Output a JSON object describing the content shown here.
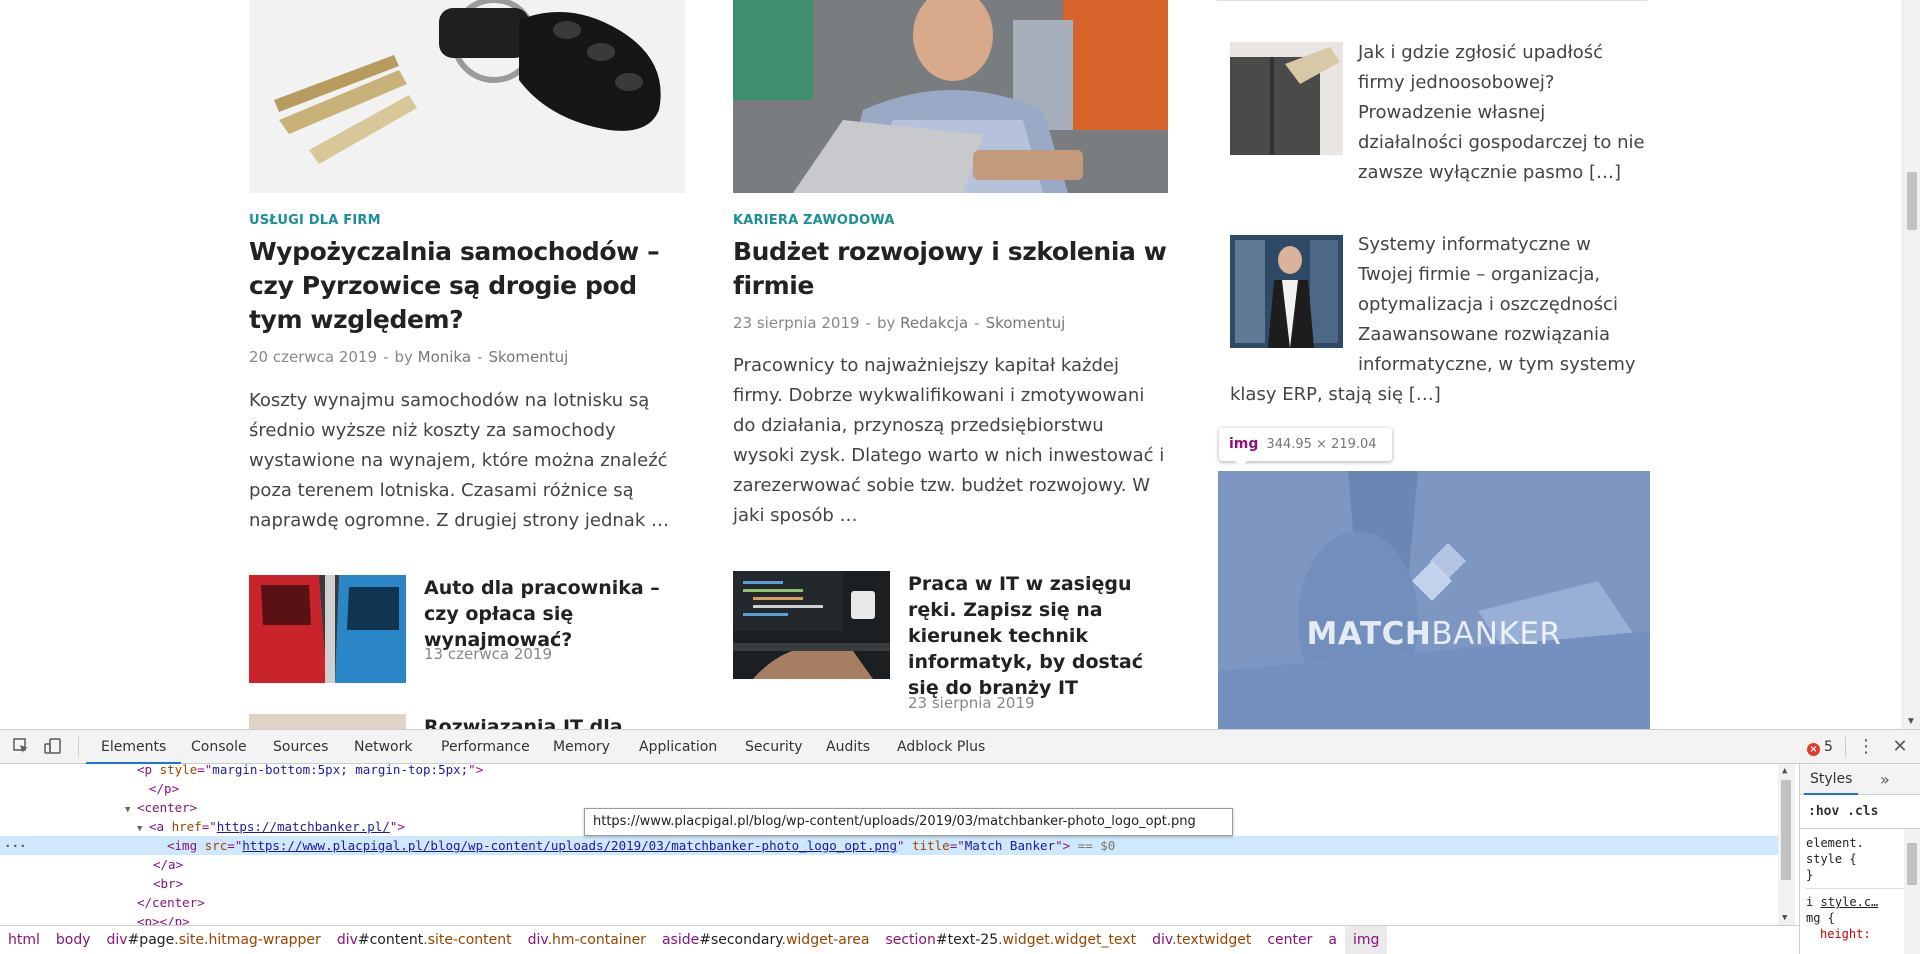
{
  "page": {
    "featured": [
      {
        "category": "USŁUGI DLA FIRM",
        "title": "Wypożyczalnia samochodów – czy Pyrzowice są drogie pod tym względem?",
        "date": "20 czerwca 2019",
        "by": "by",
        "author": "Monika",
        "comment": "Skomentuj",
        "excerpt": "Koszty wynajmu samochodów na lotnisku są średnio wyższe niż koszty za samochody wystawione na wynajem, które można znaleźć poza terenem lotniska. Czasami różnice są naprawdę ogromne. Z drugiej strony jednak …"
      },
      {
        "category": "KARIERA ZAWODOWA",
        "title": "Budżet rozwojowy i szkolenia w firmie",
        "date": "23 sierpnia 2019",
        "by": "by",
        "author": "Redakcja",
        "comment": "Skomentuj",
        "excerpt": "Pracownicy to najważniejszy kapitał każdej firmy. Dobrze wykwalifikowani i zmotywowani do działania, przynoszą przedsiębiorstwu wysoki zysk. Dlatego warto w nich inwestować i zarezerwować sobie tzw. budżet rozwojowy. W jaki sposób …"
      }
    ],
    "small_posts": [
      {
        "title": "Auto dla pracownika – czy opłaca się wynajmować?",
        "date": "13 czerwca 2019"
      },
      {
        "title": "Praca w IT w zasięgu ręki. Zapisz się na kierunek technik informatyk, by dostać się do branży IT",
        "date": "23 sierpnia 2019"
      },
      {
        "title": "Rozwiązania IT dla"
      }
    ],
    "sidebar": [
      {
        "lines": [
          "Jak i gdzie zgłosić upadłość",
          "firmy jednoosobowej?",
          "Prowadzenie własnej",
          "działalności gospodarczej to nie",
          "zawsze wyłącznie pasmo […]"
        ]
      },
      {
        "lines": [
          "Systemy informatyczne w",
          "Twojej firmie – organizacja,",
          "optymalizacja i oszczędności",
          "Zaawansowane rozwiązania",
          "informatyczne, w tym systemy"
        ],
        "cont": "klasy ERP, stają się […]"
      }
    ],
    "banner": {
      "brand_a": "MATCH",
      "brand_b": "BANKER"
    },
    "inspect_tooltip": {
      "tag": "img",
      "size": "344.95 × 219.04"
    }
  },
  "devtools": {
    "tabs": [
      "Elements",
      "Console",
      "Sources",
      "Network",
      "Performance",
      "Memory",
      "Application",
      "Security",
      "Audits",
      "Adblock Plus"
    ],
    "active_tab": "Elements",
    "error_count": "5",
    "dom": {
      "l0": {
        "tag": "p",
        "attr": "style",
        "val": "margin-bottom:5px; margin-top:5px;"
      },
      "l1": "</p>",
      "l2": "<center>",
      "l3": {
        "tag": "a",
        "attr": "href",
        "url": "https://matchbanker.pl/"
      },
      "l4": {
        "tag": "img",
        "attr1": "src",
        "url": "https://www.placpigal.pl/blog/wp-content/uploads/2019/03/matchbanker-photo_logo_opt.png",
        "attr2": "title",
        "val2": "Match Banker",
        "eq": "== $0"
      },
      "l5": "</a>",
      "l6": "<br>",
      "l7": "</center>",
      "l8": "<p></p>"
    },
    "url_tooltip": "https://www.placpigal.pl/blog/wp-content/uploads/2019/03/matchbanker-photo_logo_opt.png",
    "styles": {
      "tab": "Styles",
      "filter": ":hov .cls",
      "rule1a": "element.",
      "rule1b": "style {",
      "rule1c": "}",
      "rule2_sel": "i",
      "rule2_src": "style.c…",
      "rule2b": "mg {",
      "rule2_prop": "height:"
    },
    "breadcrumb": [
      {
        "t": "html"
      },
      {
        "t": "body"
      },
      {
        "t": "div",
        "i": "#page",
        "c": ".site.hitmag-wrapper"
      },
      {
        "t": "div",
        "i": "#content",
        "c": ".site-content"
      },
      {
        "t": "div",
        "c": ".hm-container"
      },
      {
        "t": "aside",
        "i": "#secondary",
        "c": ".widget-area"
      },
      {
        "t": "section",
        "i": "#text-25",
        "c": ".widget.widget_text"
      },
      {
        "t": "div",
        "c": ".textwidget"
      },
      {
        "t": "center"
      },
      {
        "t": "a"
      },
      {
        "t": "img"
      }
    ]
  }
}
